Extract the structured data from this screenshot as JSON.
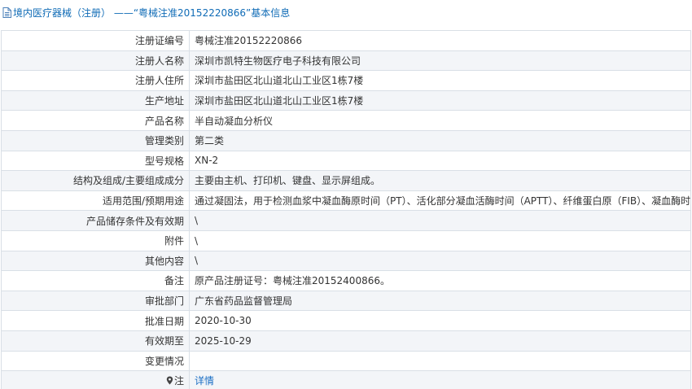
{
  "header": {
    "title": "境内医疗器械（注册） ——“粤械注准20152220866”基本信息"
  },
  "rows": [
    {
      "label": "注册证编号",
      "value": "粤械注准20152220866"
    },
    {
      "label": "注册人名称",
      "value": "深圳市凯特生物医疗电子科技有限公司"
    },
    {
      "label": "注册人住所",
      "value": "深圳市盐田区北山道北山工业区1栋7楼"
    },
    {
      "label": "生产地址",
      "value": "深圳市盐田区北山道北山工业区1栋7楼"
    },
    {
      "label": "产品名称",
      "value": "半自动凝血分析仪"
    },
    {
      "label": "管理类别",
      "value": "第二类"
    },
    {
      "label": "型号规格",
      "value": "XN-2"
    },
    {
      "label": "结构及组成/主要组成成分",
      "value": "主要由主机、打印机、键盘、显示屏组成。"
    },
    {
      "label": "适用范围/预期用途",
      "value": "通过凝固法，用于检测血浆中凝血酶原时间（PT）、活化部分凝血活酶时间（APTT）、纤维蛋白原（FIB）、凝血酶时间（TT）。"
    },
    {
      "label": "产品储存条件及有效期",
      "value": "\\"
    },
    {
      "label": "附件",
      "value": "\\"
    },
    {
      "label": "其他内容",
      "value": "\\"
    },
    {
      "label": "备注",
      "value": "原产品注册证号：粤械注准20152400866。"
    },
    {
      "label": "审批部门",
      "value": "广东省药品监督管理局"
    },
    {
      "label": "批准日期",
      "value": "2020-10-30"
    },
    {
      "label": "有效期至",
      "value": "2025-10-29"
    },
    {
      "label": "变更情况",
      "value": ""
    }
  ],
  "note": {
    "label": "注",
    "link_text": "详情",
    "icon": "map-pin-icon"
  },
  "colors": {
    "title": "#0f6bb6",
    "border": "#d9dfe6",
    "row_alt": "#f3f5f8",
    "link": "#1a6ec4"
  }
}
